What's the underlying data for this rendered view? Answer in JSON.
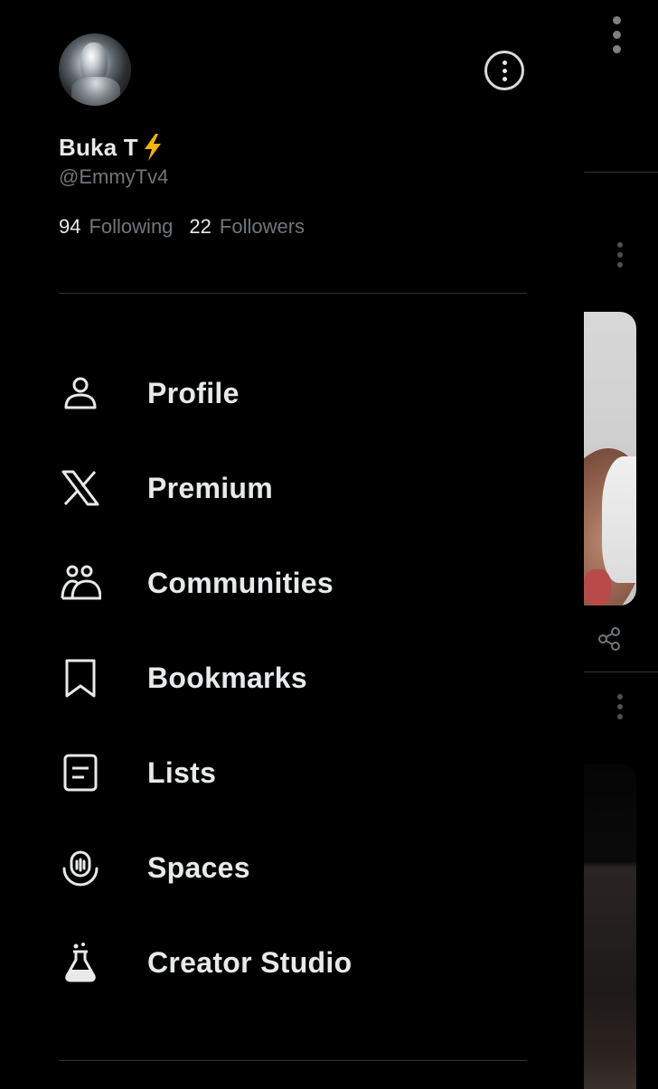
{
  "profile": {
    "display_name": "Buka T",
    "handle": "@EmmyTv4",
    "following_count": "94",
    "following_label": "Following",
    "followers_count": "22",
    "followers_label": "Followers"
  },
  "menu": {
    "items": [
      {
        "label": "Profile",
        "icon": "person-icon"
      },
      {
        "label": "Premium",
        "icon": "x-logo-icon"
      },
      {
        "label": "Communities",
        "icon": "communities-icon"
      },
      {
        "label": "Bookmarks",
        "icon": "bookmark-icon"
      },
      {
        "label": "Lists",
        "icon": "list-icon"
      },
      {
        "label": "Spaces",
        "icon": "spaces-icon"
      },
      {
        "label": "Creator Studio",
        "icon": "flask-icon"
      }
    ]
  },
  "colors": {
    "background": "#000000",
    "primary_text": "#e7e9ea",
    "secondary_text": "#71767b",
    "divider": "#2f3336",
    "badge_lightning": "#f4b400"
  }
}
